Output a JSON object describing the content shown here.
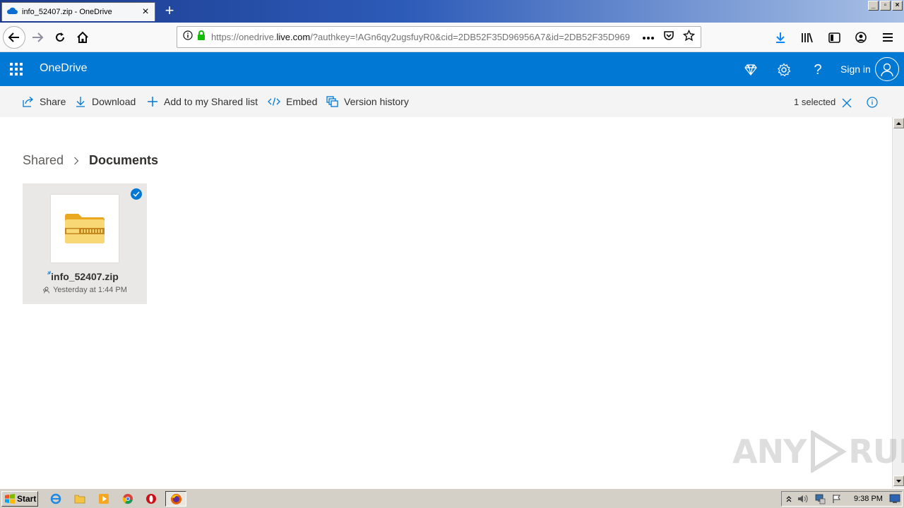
{
  "browser": {
    "tab_title": "info_52407.zip - OneDrive",
    "new_tab_label": "+",
    "url_prefix": "https://onedrive.",
    "url_host": "live.com",
    "url_rest": "/?authkey=!AGn6qy2ugsfuyR0&cid=2DB52F35D96956A7&id=2DB52F35D969"
  },
  "header": {
    "brand": "OneDrive",
    "sign_in": "Sign in",
    "help": "?"
  },
  "commands": {
    "share": "Share",
    "download": "Download",
    "add_shared": "Add to my Shared list",
    "embed": "Embed",
    "version_history": "Version history",
    "selected": "1 selected"
  },
  "breadcrumb": {
    "parent": "Shared",
    "current": "Documents"
  },
  "files": [
    {
      "name": "info_52407.zip",
      "modified": "Yesterday at 1:44 PM"
    }
  ],
  "watermark": {
    "left": "ANY",
    "right": "RUN"
  },
  "taskbar": {
    "start": "Start",
    "clock": "9:38 PM"
  },
  "colors": {
    "brand_blue": "#0078d4",
    "folder_yellow": "#f8d775",
    "zip_stripe": "#c5881f"
  }
}
